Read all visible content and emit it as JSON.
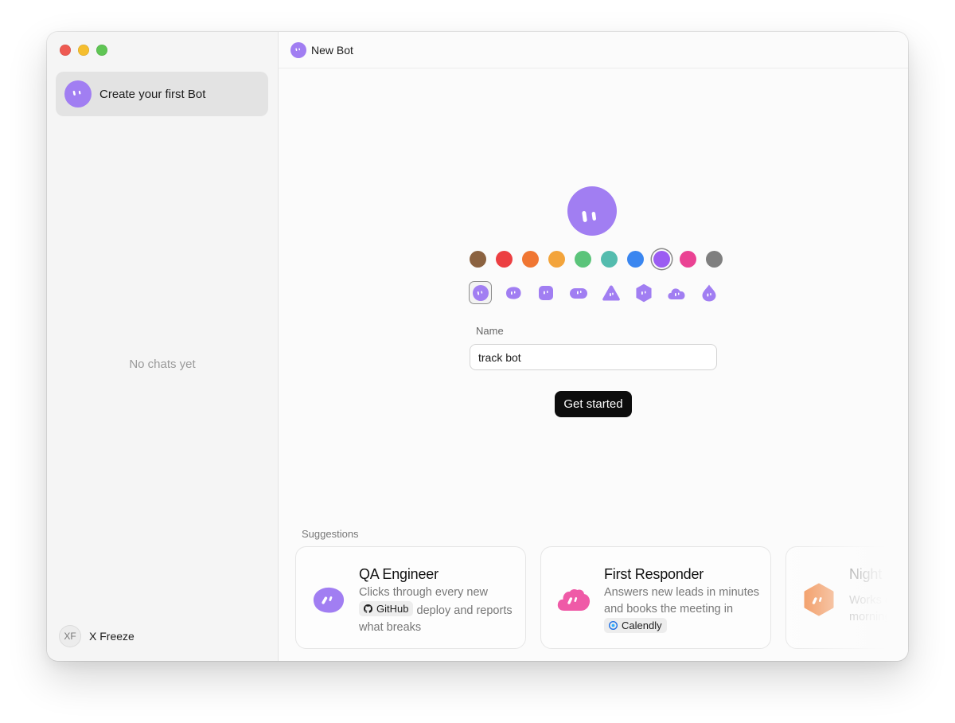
{
  "window": {
    "title": "New Bot"
  },
  "sidebar": {
    "chats": [
      {
        "label": "Create your first Bot"
      }
    ],
    "empty_text": "No chats yet",
    "user": {
      "initials": "XF",
      "name": "X Freeze"
    }
  },
  "editor": {
    "colors": [
      {
        "name": "brown",
        "hex": "#8b6240"
      },
      {
        "name": "red",
        "hex": "#ec3f42"
      },
      {
        "name": "orange",
        "hex": "#f07632"
      },
      {
        "name": "amber",
        "hex": "#f3a43b"
      },
      {
        "name": "green",
        "hex": "#5bc47a"
      },
      {
        "name": "teal",
        "hex": "#54bcae"
      },
      {
        "name": "blue",
        "hex": "#3a86f0"
      },
      {
        "name": "purple",
        "hex": "#9b5cf2",
        "selected": true
      },
      {
        "name": "pink",
        "hex": "#ea4293"
      },
      {
        "name": "gray",
        "hex": "#7f7f7f"
      }
    ],
    "shapes": [
      "circle",
      "blob",
      "rounded-square",
      "pill",
      "triangle",
      "hexagon",
      "cloud",
      "drop"
    ],
    "selected_shape": "circle",
    "name_label": "Name",
    "name_value": "track bot",
    "submit_label": "Get started"
  },
  "suggestions": {
    "title": "Suggestions",
    "cards": [
      {
        "title": "QA Engineer",
        "desc_before": "Clicks through every new",
        "chip": "GitHub",
        "desc_after": "deploy and reports what breaks",
        "color": "#a17ef2"
      },
      {
        "title": "First Responder",
        "desc_before": "Answers new leads in minutes and books the meeting in",
        "chip": "Calendly",
        "desc_after": "",
        "color": "#ef5aa7"
      },
      {
        "title": "Night Shift",
        "desc_before": "Works overnight so your morning starts clear",
        "chip": "",
        "desc_after": "",
        "color": "#f0813a"
      }
    ]
  },
  "theme": {
    "accent": "#a17ef2",
    "avatar_color": "#a17ef2",
    "button_bg": "#0d0d0d"
  }
}
